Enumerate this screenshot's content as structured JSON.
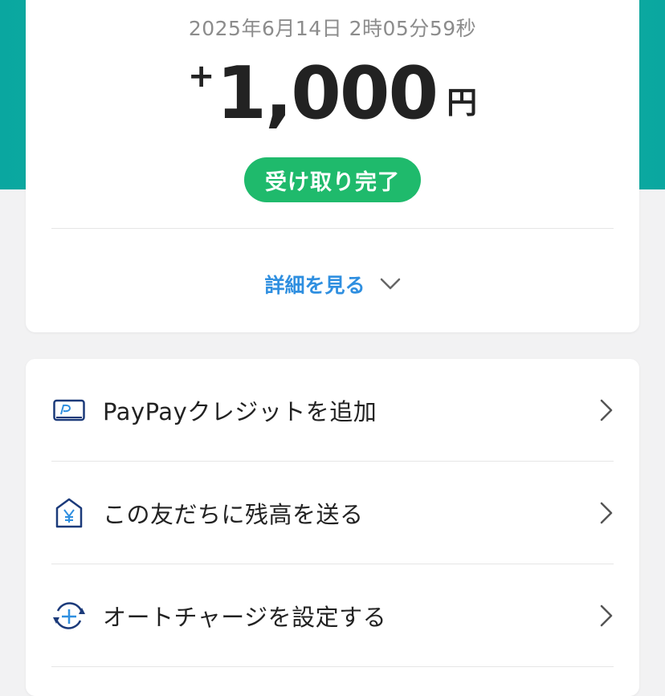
{
  "transaction": {
    "timestamp": "2025年6月14日 2時05分59秒",
    "amount_sign": "+",
    "amount": "1,000",
    "currency_unit": "円",
    "status": "受け取り完了",
    "details_link": "詳細を見る"
  },
  "actions": [
    {
      "label": "PayPayクレジットを追加",
      "icon": "credit-card-icon"
    },
    {
      "label": "この友だちに残高を送る",
      "icon": "yen-house-icon"
    },
    {
      "label": "オートチャージを設定する",
      "icon": "auto-charge-icon"
    }
  ],
  "colors": {
    "header": "#0aa7a0",
    "status_badge": "#1fba6c",
    "link": "#2f8fe0",
    "icon": "#1b3a7a"
  }
}
